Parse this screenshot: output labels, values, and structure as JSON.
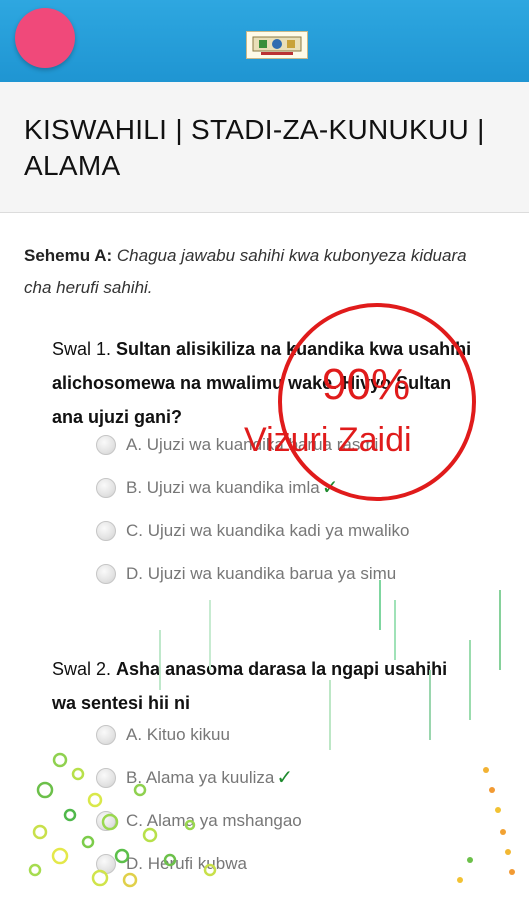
{
  "header": {
    "menu_button": "menu",
    "logo_icon": "school-logo-icon"
  },
  "page_title": "KISWAHILI | STADI-ZA-KUNUKUU | ALAMA",
  "instructions": {
    "label": "Sehemu A:",
    "text": "Chagua jawabu sahihi kwa kubonyeza kiduara cha herufi sahihi."
  },
  "result": {
    "score": "90%",
    "remark": "Vizuri Zaidi",
    "color": "#e01b1b"
  },
  "questions": [
    {
      "number": "Swal 1.",
      "text": "Sultan alisikiliza na kuandika kwa usahihi alichosomewa na mwalimu wake. Hivyo Sultan ana ujuzi gani?",
      "options": [
        {
          "label": "A. Ujuzi wa kuandika barua rasmi",
          "correct": false
        },
        {
          "label": "B. Ujuzi wa kuandika imla",
          "correct": true
        },
        {
          "label": "C. Ujuzi wa kuandika kadi ya mwaliko",
          "correct": false
        },
        {
          "label": "D. Ujuzi wa kuandika barua ya simu",
          "correct": false
        }
      ]
    },
    {
      "number": "Swal 2.",
      "text": "Asha anasoma darasa la ngapi usahihi wa sentesi hii ni",
      "options": [
        {
          "label": "A. Kituo kikuu",
          "correct": false
        },
        {
          "label": "B. Alama ya kuuliza",
          "correct": true
        },
        {
          "label": "C. Alama ya mshangao",
          "correct": false
        },
        {
          "label": "D. Herufi kubwa",
          "correct": false
        }
      ]
    }
  ],
  "tick_mark": "✓",
  "accent_colors": {
    "header": "#1f95d2",
    "fab": "#f0497a",
    "tick": "#1e8a2e"
  }
}
